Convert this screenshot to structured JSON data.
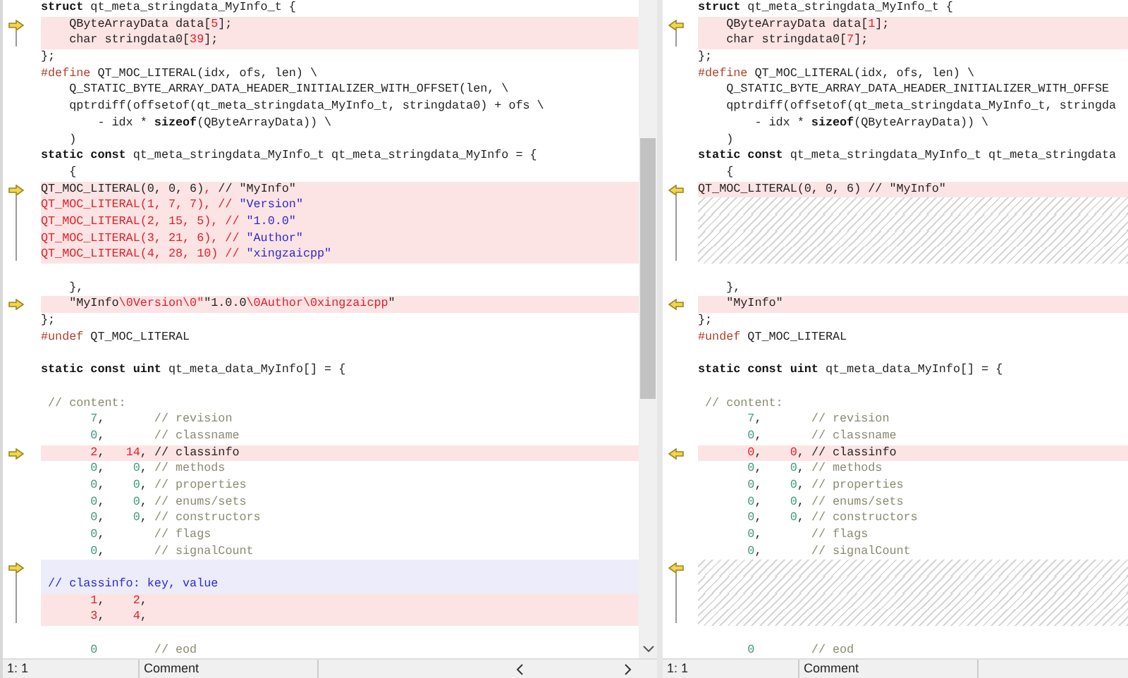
{
  "panes": [
    {
      "kind": "left",
      "lines": [
        {
          "kind": "plain",
          "tokens": [
            {
              "kind": "kw",
              "text": "struct"
            },
            {
              "kind": "tx",
              "text": " qt_meta_stringdata_MyInfo_t {"
            }
          ]
        },
        {
          "kind": "changed",
          "arrow": true,
          "tokens": [
            {
              "kind": "tx",
              "text": "    QByteArrayData data["
            },
            {
              "kind": "df",
              "text": "5"
            },
            {
              "kind": "tx",
              "text": "];"
            }
          ]
        },
        {
          "kind": "changed",
          "bracket_end": true,
          "tokens": [
            {
              "kind": "tx",
              "text": "    char stringdata0["
            },
            {
              "kind": "df",
              "text": "39"
            },
            {
              "kind": "tx",
              "text": "];"
            }
          ]
        },
        {
          "kind": "plain",
          "tokens": [
            {
              "kind": "tx",
              "text": "};"
            }
          ]
        },
        {
          "kind": "plain",
          "tokens": [
            {
              "kind": "pp",
              "text": "#define"
            },
            {
              "kind": "tx",
              "text": " QT_MOC_LITERAL(idx, ofs, len) \\"
            }
          ]
        },
        {
          "kind": "plain",
          "tokens": [
            {
              "kind": "tx",
              "text": "    Q_STATIC_BYTE_ARRAY_DATA_HEADER_INITIALIZER_WITH_OFFSET(len, \\"
            }
          ]
        },
        {
          "kind": "plain",
          "tokens": [
            {
              "kind": "tx",
              "text": "    qptrdiff(offsetof(qt_meta_stringdata_MyInfo_t, stringdata0) + ofs \\"
            }
          ]
        },
        {
          "kind": "plain",
          "tokens": [
            {
              "kind": "tx",
              "text": "        - idx * "
            },
            {
              "kind": "kw",
              "text": "sizeof"
            },
            {
              "kind": "tx",
              "text": "(QByteArrayData)) \\"
            }
          ]
        },
        {
          "kind": "plain",
          "tokens": [
            {
              "kind": "tx",
              "text": "    )"
            }
          ]
        },
        {
          "kind": "plain",
          "tokens": [
            {
              "kind": "kw",
              "text": "static const"
            },
            {
              "kind": "tx",
              "text": " qt_meta_stringdata_MyInfo_t qt_meta_stringdata_MyInfo = {"
            }
          ]
        },
        {
          "kind": "plain",
          "tokens": [
            {
              "kind": "tx",
              "text": "    {"
            }
          ]
        },
        {
          "kind": "changed",
          "arrow": true,
          "tokens": [
            {
              "kind": "tx",
              "text": "QT_MOC_LITERAL(0, 0, 6)"
            },
            {
              "kind": "df",
              "text": ", "
            },
            {
              "kind": "tx",
              "text": "// \"MyInfo\""
            }
          ]
        },
        {
          "kind": "changed",
          "bracket": true,
          "tokens": [
            {
              "kind": "df",
              "text": "QT_MOC_LITERAL(1, 7, 7), // "
            },
            {
              "kind": "st",
              "text": "\"Version\""
            }
          ]
        },
        {
          "kind": "changed",
          "bracket": true,
          "tokens": [
            {
              "kind": "df",
              "text": "QT_MOC_LITERAL(2, 15, 5), // "
            },
            {
              "kind": "st",
              "text": "\"1.0.0\""
            }
          ]
        },
        {
          "kind": "changed",
          "bracket": true,
          "tokens": [
            {
              "kind": "df",
              "text": "QT_MOC_LITERAL(3, 21, 6), // "
            },
            {
              "kind": "st",
              "text": "\"Author\""
            }
          ]
        },
        {
          "kind": "changed",
          "bracket_end": true,
          "tokens": [
            {
              "kind": "df",
              "text": "QT_MOC_LITERAL(4, 28, 10) // "
            },
            {
              "kind": "st",
              "text": "\"xingzaicpp\""
            }
          ]
        },
        {
          "kind": "plain"
        },
        {
          "kind": "plain",
          "tokens": [
            {
              "kind": "tx",
              "text": "    },"
            }
          ]
        },
        {
          "kind": "changed",
          "arrow": true,
          "tokens": [
            {
              "kind": "tx",
              "text": "    \"MyInfo"
            },
            {
              "kind": "df",
              "text": "\\0Version\\0\""
            },
            {
              "kind": "tx",
              "text": "\"1.0.0"
            },
            {
              "kind": "df",
              "text": "\\0Author\\0xingzaicpp"
            },
            {
              "kind": "tx",
              "text": "\""
            }
          ]
        },
        {
          "kind": "plain",
          "tokens": [
            {
              "kind": "tx",
              "text": "};"
            }
          ]
        },
        {
          "kind": "plain",
          "tokens": [
            {
              "kind": "pp",
              "text": "#undef"
            },
            {
              "kind": "tx",
              "text": " QT_MOC_LITERAL"
            }
          ]
        },
        {
          "kind": "plain"
        },
        {
          "kind": "plain",
          "tokens": [
            {
              "kind": "kw",
              "text": "static const uint"
            },
            {
              "kind": "tx",
              "text": " qt_meta_data_MyInfo[] = {"
            }
          ]
        },
        {
          "kind": "plain"
        },
        {
          "kind": "plain",
          "tokens": [
            {
              "kind": "cm",
              "text": " // content:"
            }
          ]
        },
        {
          "kind": "plain",
          "tokens": [
            {
              "kind": "nm",
              "text": "       7"
            },
            {
              "kind": "tx",
              "text": ","
            },
            {
              "kind": "cm",
              "text": "       // revision"
            }
          ]
        },
        {
          "kind": "plain",
          "tokens": [
            {
              "kind": "nm",
              "text": "       0"
            },
            {
              "kind": "tx",
              "text": ","
            },
            {
              "kind": "cm",
              "text": "       // classname"
            }
          ]
        },
        {
          "kind": "changed",
          "arrow": true,
          "tokens": [
            {
              "kind": "df",
              "text": "       2"
            },
            {
              "kind": "tx",
              "text": ","
            },
            {
              "kind": "df",
              "text": "   14"
            },
            {
              "kind": "tx",
              "text": ", // classinfo"
            }
          ]
        },
        {
          "kind": "plain",
          "tokens": [
            {
              "kind": "nm",
              "text": "       0"
            },
            {
              "kind": "tx",
              "text": ","
            },
            {
              "kind": "nm",
              "text": "    0"
            },
            {
              "kind": "tx",
              "text": ","
            },
            {
              "kind": "cm",
              "text": " // methods"
            }
          ]
        },
        {
          "kind": "plain",
          "tokens": [
            {
              "kind": "nm",
              "text": "       0"
            },
            {
              "kind": "tx",
              "text": ","
            },
            {
              "kind": "nm",
              "text": "    0"
            },
            {
              "kind": "tx",
              "text": ","
            },
            {
              "kind": "cm",
              "text": " // properties"
            }
          ]
        },
        {
          "kind": "plain",
          "tokens": [
            {
              "kind": "nm",
              "text": "       0"
            },
            {
              "kind": "tx",
              "text": ","
            },
            {
              "kind": "nm",
              "text": "    0"
            },
            {
              "kind": "tx",
              "text": ","
            },
            {
              "kind": "cm",
              "text": " // enums/sets"
            }
          ]
        },
        {
          "kind": "plain",
          "tokens": [
            {
              "kind": "nm",
              "text": "       0"
            },
            {
              "kind": "tx",
              "text": ","
            },
            {
              "kind": "nm",
              "text": "    0"
            },
            {
              "kind": "tx",
              "text": ","
            },
            {
              "kind": "cm",
              "text": " // constructors"
            }
          ]
        },
        {
          "kind": "plain",
          "tokens": [
            {
              "kind": "nm",
              "text": "       0"
            },
            {
              "kind": "tx",
              "text": ","
            },
            {
              "kind": "cm",
              "text": "       // flags"
            }
          ]
        },
        {
          "kind": "plain",
          "tokens": [
            {
              "kind": "nm",
              "text": "       0"
            },
            {
              "kind": "tx",
              "text": ","
            },
            {
              "kind": "cm",
              "text": "       // signalCount"
            }
          ]
        },
        {
          "kind": "note",
          "arrow": true
        },
        {
          "kind": "note",
          "bracket": true,
          "tokens": [
            {
              "kind": "st",
              "text": " // classinfo: key, value"
            }
          ]
        },
        {
          "kind": "changed",
          "bracket": true,
          "tokens": [
            {
              "kind": "df",
              "text": "       1"
            },
            {
              "kind": "tx",
              "text": ","
            },
            {
              "kind": "df",
              "text": "    2"
            },
            {
              "kind": "tx",
              "text": ","
            }
          ]
        },
        {
          "kind": "changed",
          "bracket_end": true,
          "tokens": [
            {
              "kind": "df",
              "text": "       3"
            },
            {
              "kind": "tx",
              "text": ","
            },
            {
              "kind": "df",
              "text": "    4"
            },
            {
              "kind": "tx",
              "text": ","
            }
          ]
        },
        {
          "kind": "plain"
        },
        {
          "kind": "plain",
          "tokens": [
            {
              "kind": "nm",
              "text": "       0"
            },
            {
              "kind": "cm",
              "text": "        // eod"
            }
          ]
        }
      ],
      "status": {
        "position": "1: 1",
        "mode": "Comment"
      }
    },
    {
      "kind": "right",
      "lines": [
        {
          "kind": "plain",
          "tokens": [
            {
              "kind": "kw",
              "text": "struct"
            },
            {
              "kind": "tx",
              "text": " qt_meta_stringdata_MyInfo_t {"
            }
          ]
        },
        {
          "kind": "changed",
          "arrow": true,
          "tokens": [
            {
              "kind": "tx",
              "text": "    QByteArrayData data["
            },
            {
              "kind": "df",
              "text": "1"
            },
            {
              "kind": "tx",
              "text": "];"
            }
          ]
        },
        {
          "kind": "changed",
          "bracket_end": true,
          "tokens": [
            {
              "kind": "tx",
              "text": "    char stringdata0["
            },
            {
              "kind": "df",
              "text": "7"
            },
            {
              "kind": "tx",
              "text": "];"
            }
          ]
        },
        {
          "kind": "plain",
          "tokens": [
            {
              "kind": "tx",
              "text": "};"
            }
          ]
        },
        {
          "kind": "plain",
          "tokens": [
            {
              "kind": "pp",
              "text": "#define"
            },
            {
              "kind": "tx",
              "text": " QT_MOC_LITERAL(idx, ofs, len) \\"
            }
          ]
        },
        {
          "kind": "plain",
          "tokens": [
            {
              "kind": "tx",
              "text": "    Q_STATIC_BYTE_ARRAY_DATA_HEADER_INITIALIZER_WITH_OFFSE"
            }
          ]
        },
        {
          "kind": "plain",
          "tokens": [
            {
              "kind": "tx",
              "text": "    qptrdiff(offsetof(qt_meta_stringdata_MyInfo_t, stringda"
            }
          ]
        },
        {
          "kind": "plain",
          "tokens": [
            {
              "kind": "tx",
              "text": "        - idx * "
            },
            {
              "kind": "kw",
              "text": "sizeof"
            },
            {
              "kind": "tx",
              "text": "(QByteArrayData)) \\"
            }
          ]
        },
        {
          "kind": "plain",
          "tokens": [
            {
              "kind": "tx",
              "text": "    )"
            }
          ]
        },
        {
          "kind": "plain",
          "tokens": [
            {
              "kind": "kw",
              "text": "static const"
            },
            {
              "kind": "tx",
              "text": " qt_meta_stringdata_MyInfo_t qt_meta_stringdata"
            }
          ]
        },
        {
          "kind": "plain",
          "tokens": [
            {
              "kind": "tx",
              "text": "    {"
            }
          ]
        },
        {
          "kind": "changed",
          "arrow": true,
          "tokens": [
            {
              "kind": "tx",
              "text": "QT_MOC_LITERAL(0, 0, 6) // \"MyInfo\""
            }
          ]
        },
        {
          "kind": "filler",
          "bracket": true
        },
        {
          "kind": "filler",
          "bracket": true
        },
        {
          "kind": "filler",
          "bracket": true
        },
        {
          "kind": "filler",
          "bracket_end": true
        },
        {
          "kind": "plain"
        },
        {
          "kind": "plain",
          "tokens": [
            {
              "kind": "tx",
              "text": "    },"
            }
          ]
        },
        {
          "kind": "changed",
          "arrow": true,
          "tokens": [
            {
              "kind": "tx",
              "text": "    \"MyInfo\""
            }
          ]
        },
        {
          "kind": "plain",
          "tokens": [
            {
              "kind": "tx",
              "text": "};"
            }
          ]
        },
        {
          "kind": "plain",
          "tokens": [
            {
              "kind": "pp",
              "text": "#undef"
            },
            {
              "kind": "tx",
              "text": " QT_MOC_LITERAL"
            }
          ]
        },
        {
          "kind": "plain"
        },
        {
          "kind": "plain",
          "tokens": [
            {
              "kind": "kw",
              "text": "static const uint"
            },
            {
              "kind": "tx",
              "text": " qt_meta_data_MyInfo[] = {"
            }
          ]
        },
        {
          "kind": "plain"
        },
        {
          "kind": "plain",
          "tokens": [
            {
              "kind": "cm",
              "text": " // content:"
            }
          ]
        },
        {
          "kind": "plain",
          "tokens": [
            {
              "kind": "nm",
              "text": "       7"
            },
            {
              "kind": "tx",
              "text": ","
            },
            {
              "kind": "cm",
              "text": "       // revision"
            }
          ]
        },
        {
          "kind": "plain",
          "tokens": [
            {
              "kind": "nm",
              "text": "       0"
            },
            {
              "kind": "tx",
              "text": ","
            },
            {
              "kind": "cm",
              "text": "       // classname"
            }
          ]
        },
        {
          "kind": "changed",
          "arrow": true,
          "tokens": [
            {
              "kind": "df",
              "text": "       0"
            },
            {
              "kind": "tx",
              "text": ","
            },
            {
              "kind": "df",
              "text": "    0"
            },
            {
              "kind": "tx",
              "text": ", // classinfo"
            }
          ]
        },
        {
          "kind": "plain",
          "tokens": [
            {
              "kind": "nm",
              "text": "       0"
            },
            {
              "kind": "tx",
              "text": ","
            },
            {
              "kind": "nm",
              "text": "    0"
            },
            {
              "kind": "tx",
              "text": ","
            },
            {
              "kind": "cm",
              "text": " // methods"
            }
          ]
        },
        {
          "kind": "plain",
          "tokens": [
            {
              "kind": "nm",
              "text": "       0"
            },
            {
              "kind": "tx",
              "text": ","
            },
            {
              "kind": "nm",
              "text": "    0"
            },
            {
              "kind": "tx",
              "text": ","
            },
            {
              "kind": "cm",
              "text": " // properties"
            }
          ]
        },
        {
          "kind": "plain",
          "tokens": [
            {
              "kind": "nm",
              "text": "       0"
            },
            {
              "kind": "tx",
              "text": ","
            },
            {
              "kind": "nm",
              "text": "    0"
            },
            {
              "kind": "tx",
              "text": ","
            },
            {
              "kind": "cm",
              "text": " // enums/sets"
            }
          ]
        },
        {
          "kind": "plain",
          "tokens": [
            {
              "kind": "nm",
              "text": "       0"
            },
            {
              "kind": "tx",
              "text": ","
            },
            {
              "kind": "nm",
              "text": "    0"
            },
            {
              "kind": "tx",
              "text": ","
            },
            {
              "kind": "cm",
              "text": " // constructors"
            }
          ]
        },
        {
          "kind": "plain",
          "tokens": [
            {
              "kind": "nm",
              "text": "       0"
            },
            {
              "kind": "tx",
              "text": ","
            },
            {
              "kind": "cm",
              "text": "       // flags"
            }
          ]
        },
        {
          "kind": "plain",
          "tokens": [
            {
              "kind": "nm",
              "text": "       0"
            },
            {
              "kind": "tx",
              "text": ","
            },
            {
              "kind": "cm",
              "text": "       // signalCount"
            }
          ]
        },
        {
          "kind": "filler",
          "arrow": true
        },
        {
          "kind": "filler",
          "bracket": true
        },
        {
          "kind": "filler",
          "bracket": true
        },
        {
          "kind": "filler",
          "bracket_end": true
        },
        {
          "kind": "plain"
        },
        {
          "kind": "plain",
          "tokens": [
            {
              "kind": "nm",
              "text": "       0"
            },
            {
              "kind": "cm",
              "text": "        // eod"
            }
          ]
        }
      ],
      "status": {
        "position": "1: 1",
        "mode": "Comment"
      }
    }
  ]
}
